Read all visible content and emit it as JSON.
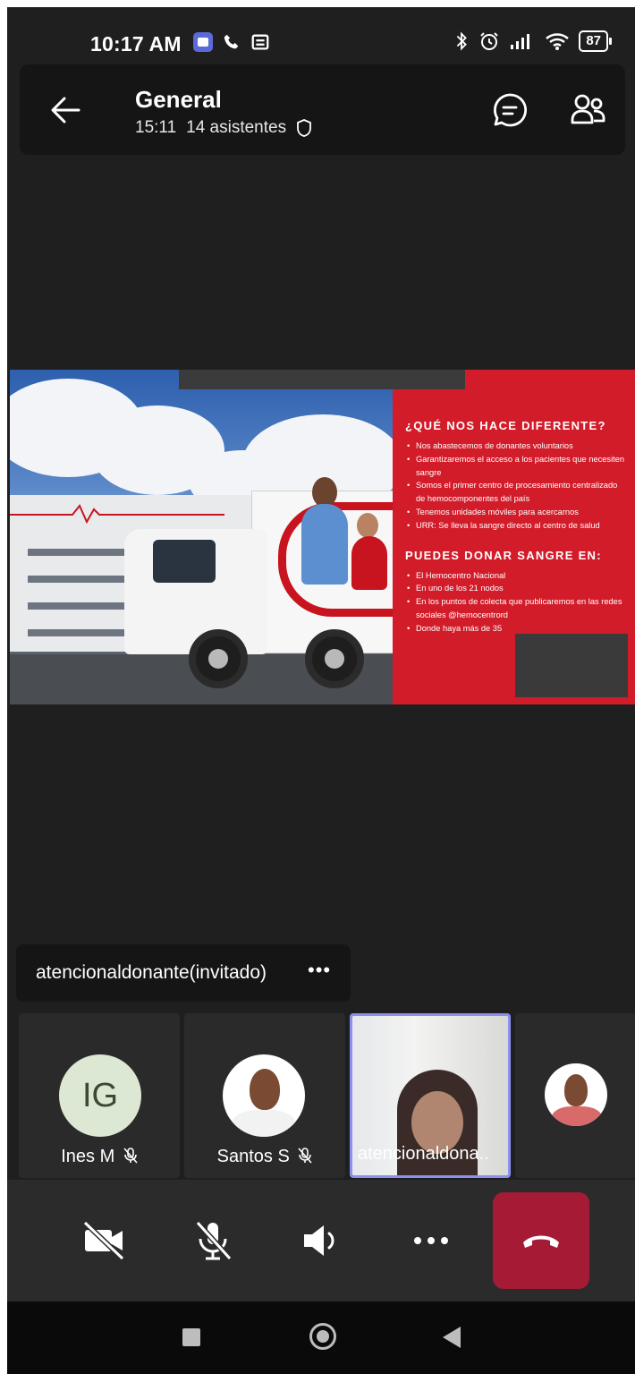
{
  "status_bar": {
    "time": "10:17 AM",
    "battery": "87",
    "left_icons": [
      "teams-icon",
      "phone-icon",
      "message-icon"
    ],
    "right_icons": [
      "bluetooth-icon",
      "alarm-icon",
      "signal-icon",
      "wifi-icon",
      "battery-icon"
    ]
  },
  "header": {
    "title": "General",
    "duration": "15:11",
    "attendees": "14 asistentes"
  },
  "shared_content": {
    "heading1": "¿QUÉ NOS HACE DIFERENTE?",
    "items1": [
      "Nos abastecemos de donantes voluntarios",
      "Garantizaremos el acceso a los pacientes que necesiten sangre",
      "Somos el primer centro de procesamiento centralizado de hemocomponentes del país",
      "Tenemos unidades móviles para acercarnos",
      "URR: Se lleva la sangre directo al centro de salud"
    ],
    "heading2": "PUEDES DONAR SANGRE EN:",
    "items2": [
      "El Hemocentro Nacional",
      "En uno de los 21 nodos",
      "En los puntos de colecta que publicaremos en las redes sociales @hemocentrord",
      "Donde haya más de 35"
    ],
    "colors": {
      "panel": "#d21c2a"
    }
  },
  "presenter": {
    "name": "atencionaldonante(invitado)",
    "more": "•••"
  },
  "participants": [
    {
      "initials": "IG",
      "name": "Ines M"
    },
    {
      "name": "Santos S"
    },
    {
      "name": "atencionaldona.."
    },
    {
      "name": ""
    }
  ],
  "controls": {
    "colors": {
      "hangup": "#a51b36",
      "active_border": "#8b8ff0"
    }
  }
}
